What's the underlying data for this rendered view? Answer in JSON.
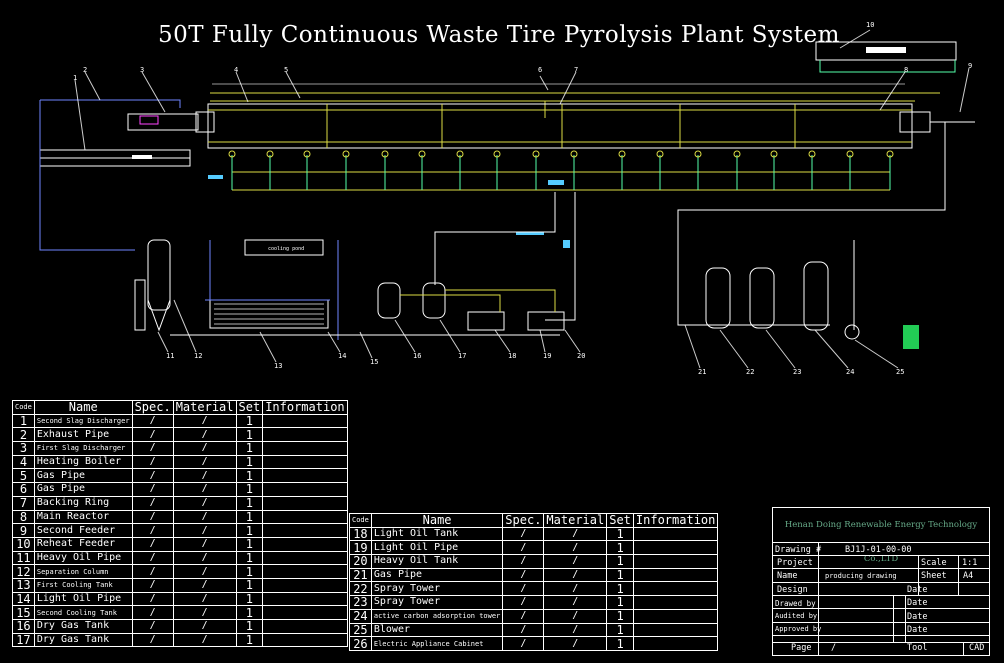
{
  "title": "50T Fully Continuous Waste Tire Pyrolysis Plant System",
  "callouts": [
    "1",
    "2",
    "3",
    "4",
    "5",
    "6",
    "7",
    "8",
    "9",
    "10",
    "11",
    "12",
    "13",
    "14",
    "15",
    "16",
    "17",
    "18",
    "19",
    "20",
    "21",
    "22",
    "23",
    "24",
    "25"
  ],
  "tank_label": "cooling pond",
  "table_headers": {
    "code": "Code",
    "name": "Name",
    "spec": "Spec.",
    "material": "Material",
    "set": "Set",
    "information": "Information"
  },
  "table_a": [
    {
      "code": "1",
      "name": "Second Slag Discharger",
      "small": true
    },
    {
      "code": "2",
      "name": "Exhaust Pipe"
    },
    {
      "code": "3",
      "name": "First Slag Discharger",
      "small": true
    },
    {
      "code": "4",
      "name": "Heating Boiler"
    },
    {
      "code": "5",
      "name": "Gas Pipe"
    },
    {
      "code": "6",
      "name": "Gas Pipe"
    },
    {
      "code": "7",
      "name": "Backing Ring"
    },
    {
      "code": "8",
      "name": "Main Reactor"
    },
    {
      "code": "9",
      "name": "Second Feeder"
    },
    {
      "code": "10",
      "name": "Reheat Feeder"
    },
    {
      "code": "11",
      "name": "Heavy Oil Pipe"
    },
    {
      "code": "12",
      "name": "Separation Column",
      "small": true
    },
    {
      "code": "13",
      "name": "First Cooling Tank",
      "small": true
    },
    {
      "code": "14",
      "name": "Light Oil Pipe"
    },
    {
      "code": "15",
      "name": "Second Cooling Tank",
      "small": true
    },
    {
      "code": "16",
      "name": "Dry Gas Tank"
    },
    {
      "code": "17",
      "name": "Dry Gas Tank"
    }
  ],
  "table_b": [
    {
      "code": "18",
      "name": "Light Oil Tank"
    },
    {
      "code": "19",
      "name": "Light Oil Pipe"
    },
    {
      "code": "20",
      "name": "Heavy Oil Tank"
    },
    {
      "code": "21",
      "name": "Gas Pipe"
    },
    {
      "code": "22",
      "name": "Spray Tower"
    },
    {
      "code": "23",
      "name": "Spray Tower"
    },
    {
      "code": "24",
      "name": "active carbon adsorption tower",
      "small": true
    },
    {
      "code": "25",
      "name": "Blower"
    },
    {
      "code": "26",
      "name": "Electric Appliance Cabinet",
      "small": true
    }
  ],
  "cell_spec": "/",
  "cell_material": "/",
  "cell_set": "1",
  "title_block": {
    "company": "Henan Doing Renewable Energy Technology Co.,LTD",
    "drawing_label": "Drawing #",
    "drawing_no": "BJ1J-01-00-00",
    "project_label": "Project",
    "scale_label": "Scale",
    "scale": "1:1",
    "name_label": "Name",
    "name_value": "producing drawing",
    "sheet_label": "Sheet",
    "sheet_value": "A4",
    "design_label": "Design",
    "drawn_label": "Drawed by",
    "audited_label": "Audited by",
    "approved_label": "Approved by",
    "date_label": "Date",
    "page_label": "Page",
    "page_value": "/",
    "tool_label": "Tool",
    "tool_value": "CAD"
  }
}
